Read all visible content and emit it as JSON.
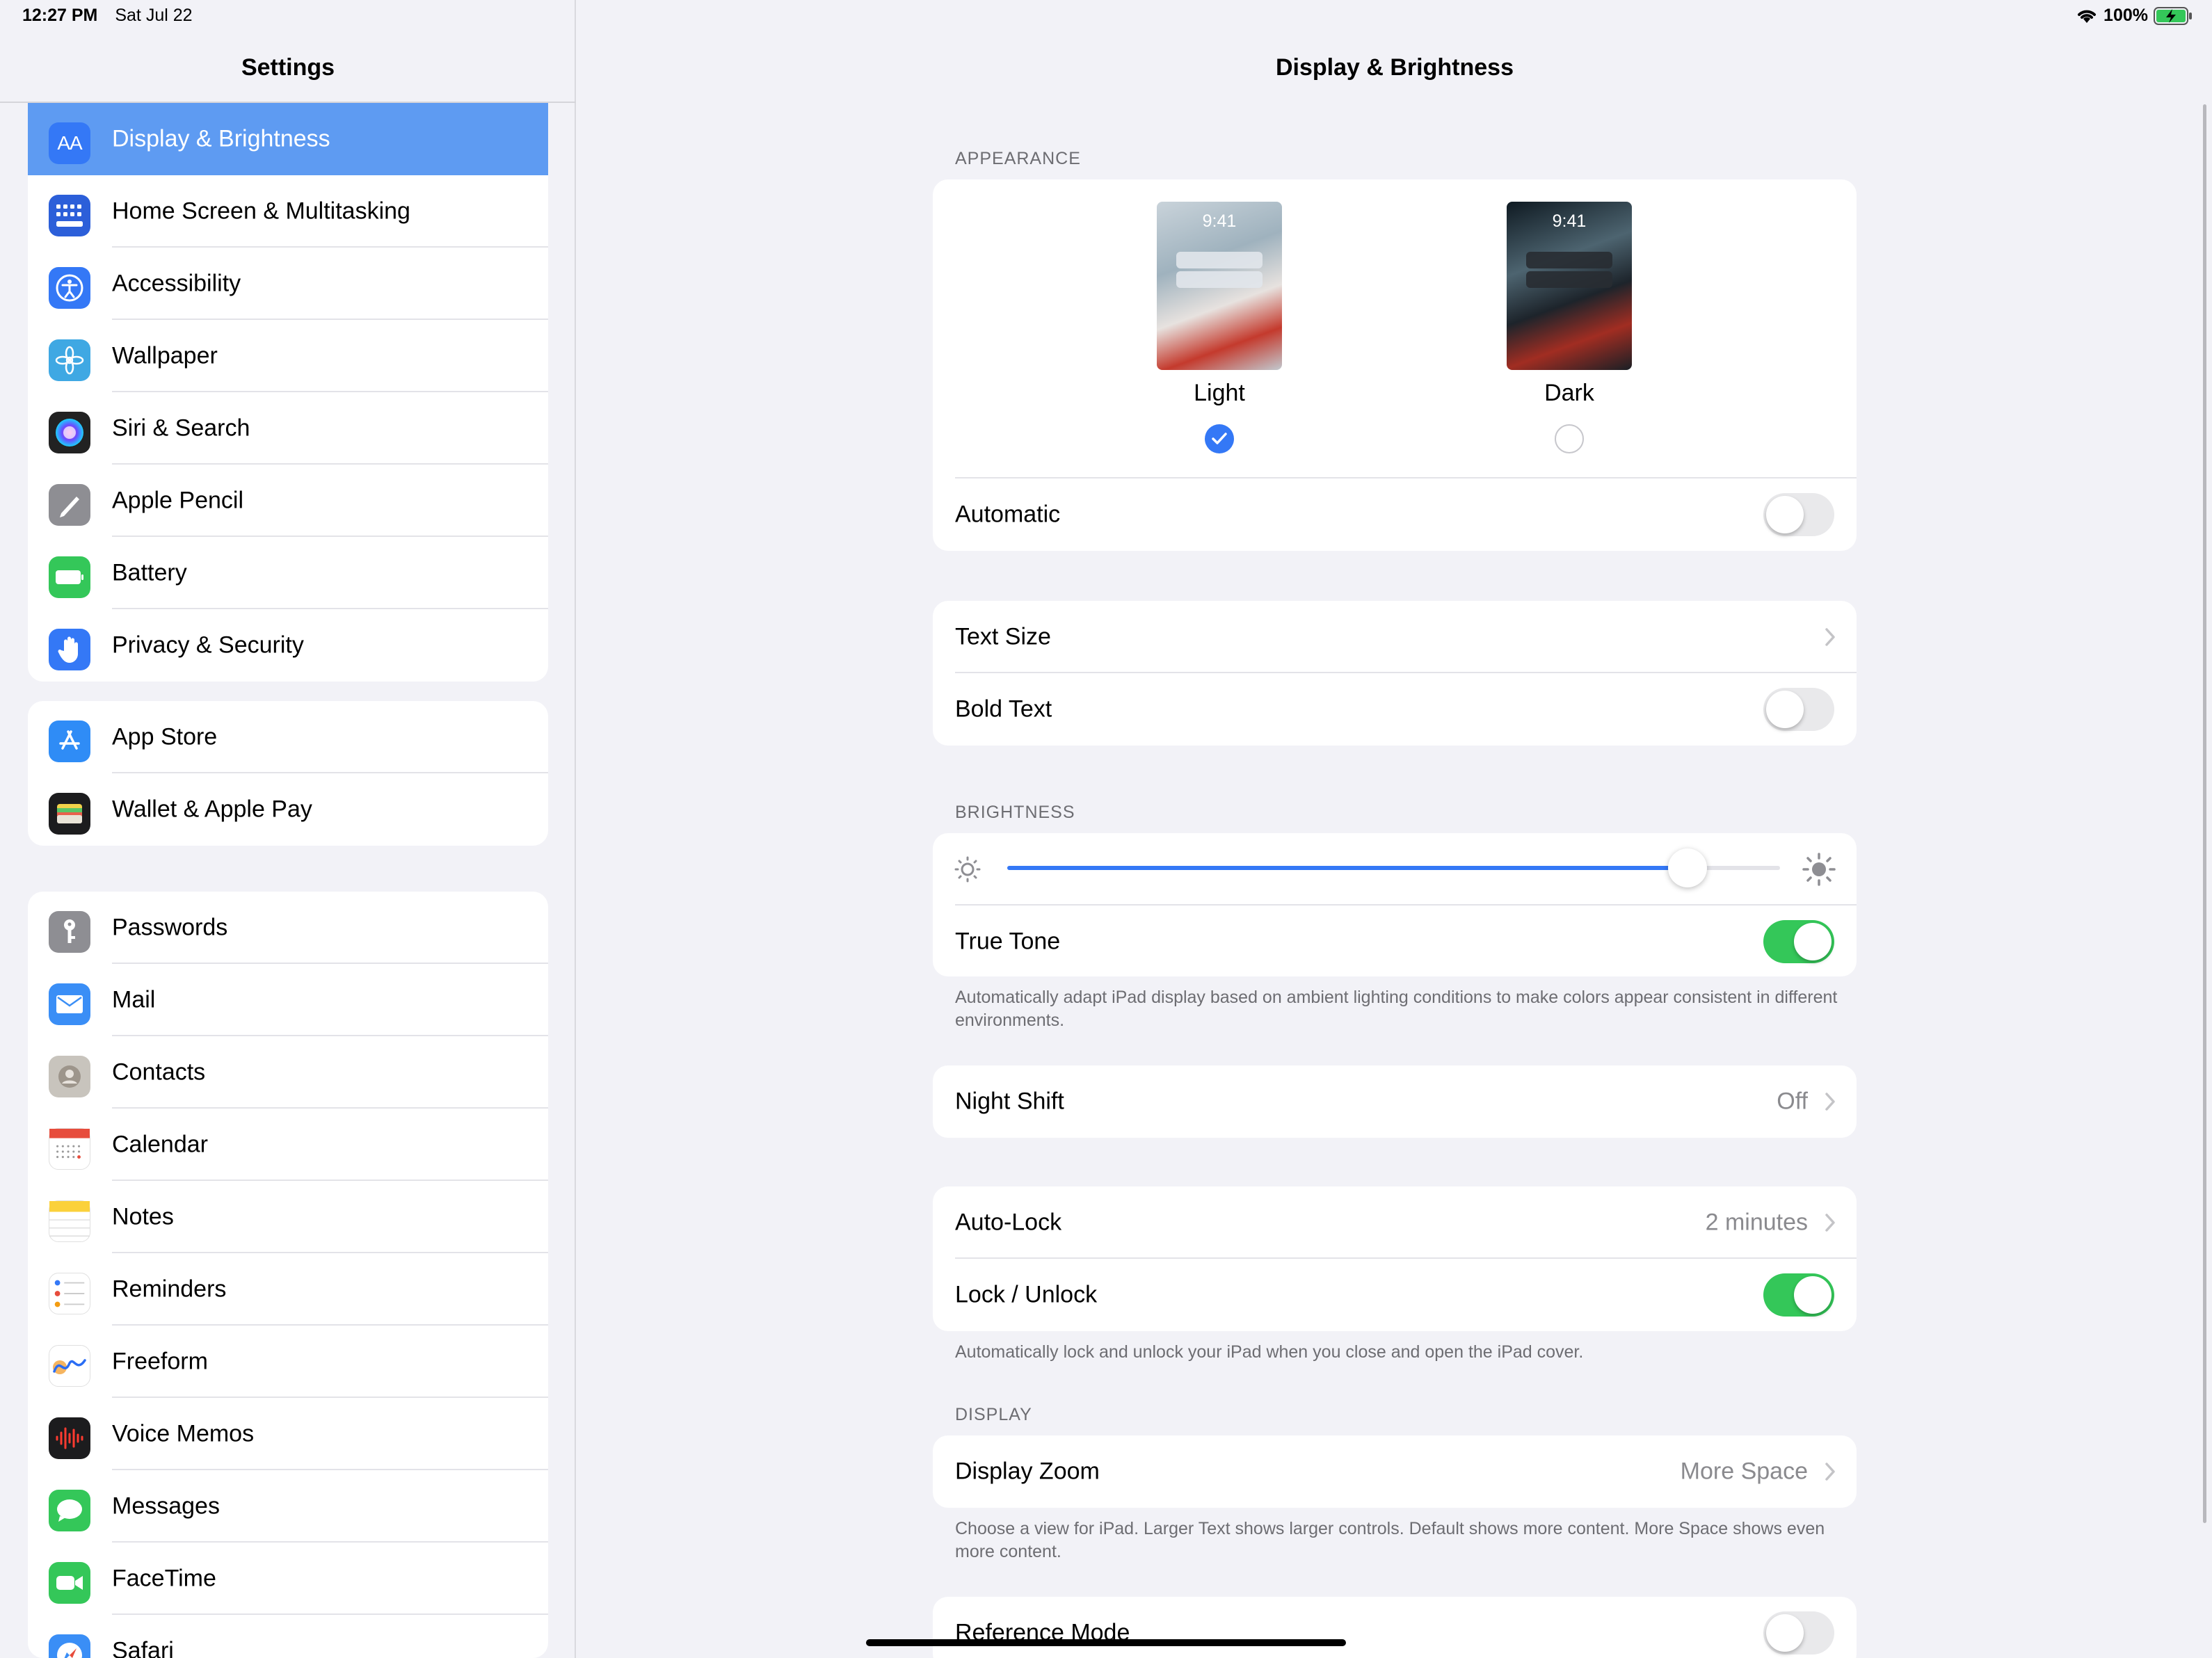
{
  "status_bar": {
    "time": "12:27 PM",
    "date": "Sat Jul 22",
    "battery": "100%"
  },
  "sidebar": {
    "title": "Settings",
    "groups": [
      {
        "items": [
          {
            "label": "Display & Brightness",
            "icon": "aa-icon",
            "color": "#3478f6",
            "active": true
          },
          {
            "label": "Home Screen & Multitasking",
            "icon": "grid-icon",
            "color": "#2c5fd9"
          },
          {
            "label": "Accessibility",
            "icon": "accessibility-icon",
            "color": "#3478f6"
          },
          {
            "label": "Wallpaper",
            "icon": "flower-icon",
            "color": "#3fa8e3"
          },
          {
            "label": "Siri & Search",
            "icon": "siri-icon",
            "color": "#222222"
          },
          {
            "label": "Apple Pencil",
            "icon": "pencil-icon",
            "color": "#8e8e93"
          },
          {
            "label": "Battery",
            "icon": "battery-icon",
            "color": "#34c759"
          },
          {
            "label": "Privacy & Security",
            "icon": "hand-icon",
            "color": "#3478f6"
          }
        ]
      },
      {
        "items": [
          {
            "label": "App Store",
            "icon": "appstore-icon",
            "color": "#2f8cf6"
          },
          {
            "label": "Wallet & Apple Pay",
            "icon": "wallet-icon",
            "color": "#1c1c1e"
          }
        ]
      },
      {
        "items": [
          {
            "label": "Passwords",
            "icon": "key-icon",
            "color": "#8e8e93"
          },
          {
            "label": "Mail",
            "icon": "mail-icon",
            "color": "#3a8ef6"
          },
          {
            "label": "Contacts",
            "icon": "contacts-icon",
            "color": "#c8c4bd"
          },
          {
            "label": "Calendar",
            "icon": "calendar-icon",
            "color": "#ffffff"
          },
          {
            "label": "Notes",
            "icon": "notes-icon",
            "color": "#ffffff"
          },
          {
            "label": "Reminders",
            "icon": "reminders-icon",
            "color": "#ffffff"
          },
          {
            "label": "Freeform",
            "icon": "freeform-icon",
            "color": "#ffffff"
          },
          {
            "label": "Voice Memos",
            "icon": "waveform-icon",
            "color": "#1c1c1e"
          },
          {
            "label": "Messages",
            "icon": "messages-icon",
            "color": "#34c759"
          },
          {
            "label": "FaceTime",
            "icon": "video-icon",
            "color": "#34c759"
          },
          {
            "label": "Safari",
            "icon": "compass-icon",
            "color": "#3a8ef6"
          }
        ]
      }
    ]
  },
  "detail": {
    "title": "Display & Brightness",
    "appearance": {
      "header": "APPEARANCE",
      "light": {
        "label": "Light",
        "time": "9:41",
        "selected": true
      },
      "dark": {
        "label": "Dark",
        "time": "9:41",
        "selected": false
      },
      "automatic": {
        "label": "Automatic",
        "on": false
      }
    },
    "text": {
      "text_size": "Text Size",
      "bold_text": {
        "label": "Bold Text",
        "on": false
      }
    },
    "brightness": {
      "header": "BRIGHTNESS",
      "level": 0.88,
      "true_tone": {
        "label": "True Tone",
        "on": true
      },
      "footnote": "Automatically adapt iPad display based on ambient lighting conditions to make colors appear consistent in different environments."
    },
    "night_shift": {
      "label": "Night Shift",
      "value": "Off"
    },
    "lock": {
      "auto_lock": {
        "label": "Auto-Lock",
        "value": "2 minutes"
      },
      "lock_unlock": {
        "label": "Lock / Unlock",
        "on": true
      },
      "footnote": "Automatically lock and unlock your iPad when you close and open the iPad cover."
    },
    "display": {
      "header": "DISPLAY",
      "zoom": {
        "label": "Display Zoom",
        "value": "More Space"
      },
      "footnote": "Choose a view for iPad. Larger Text shows larger controls. Default shows more content. More Space shows even more content.",
      "reference_mode": {
        "label": "Reference Mode",
        "on": false
      }
    }
  }
}
